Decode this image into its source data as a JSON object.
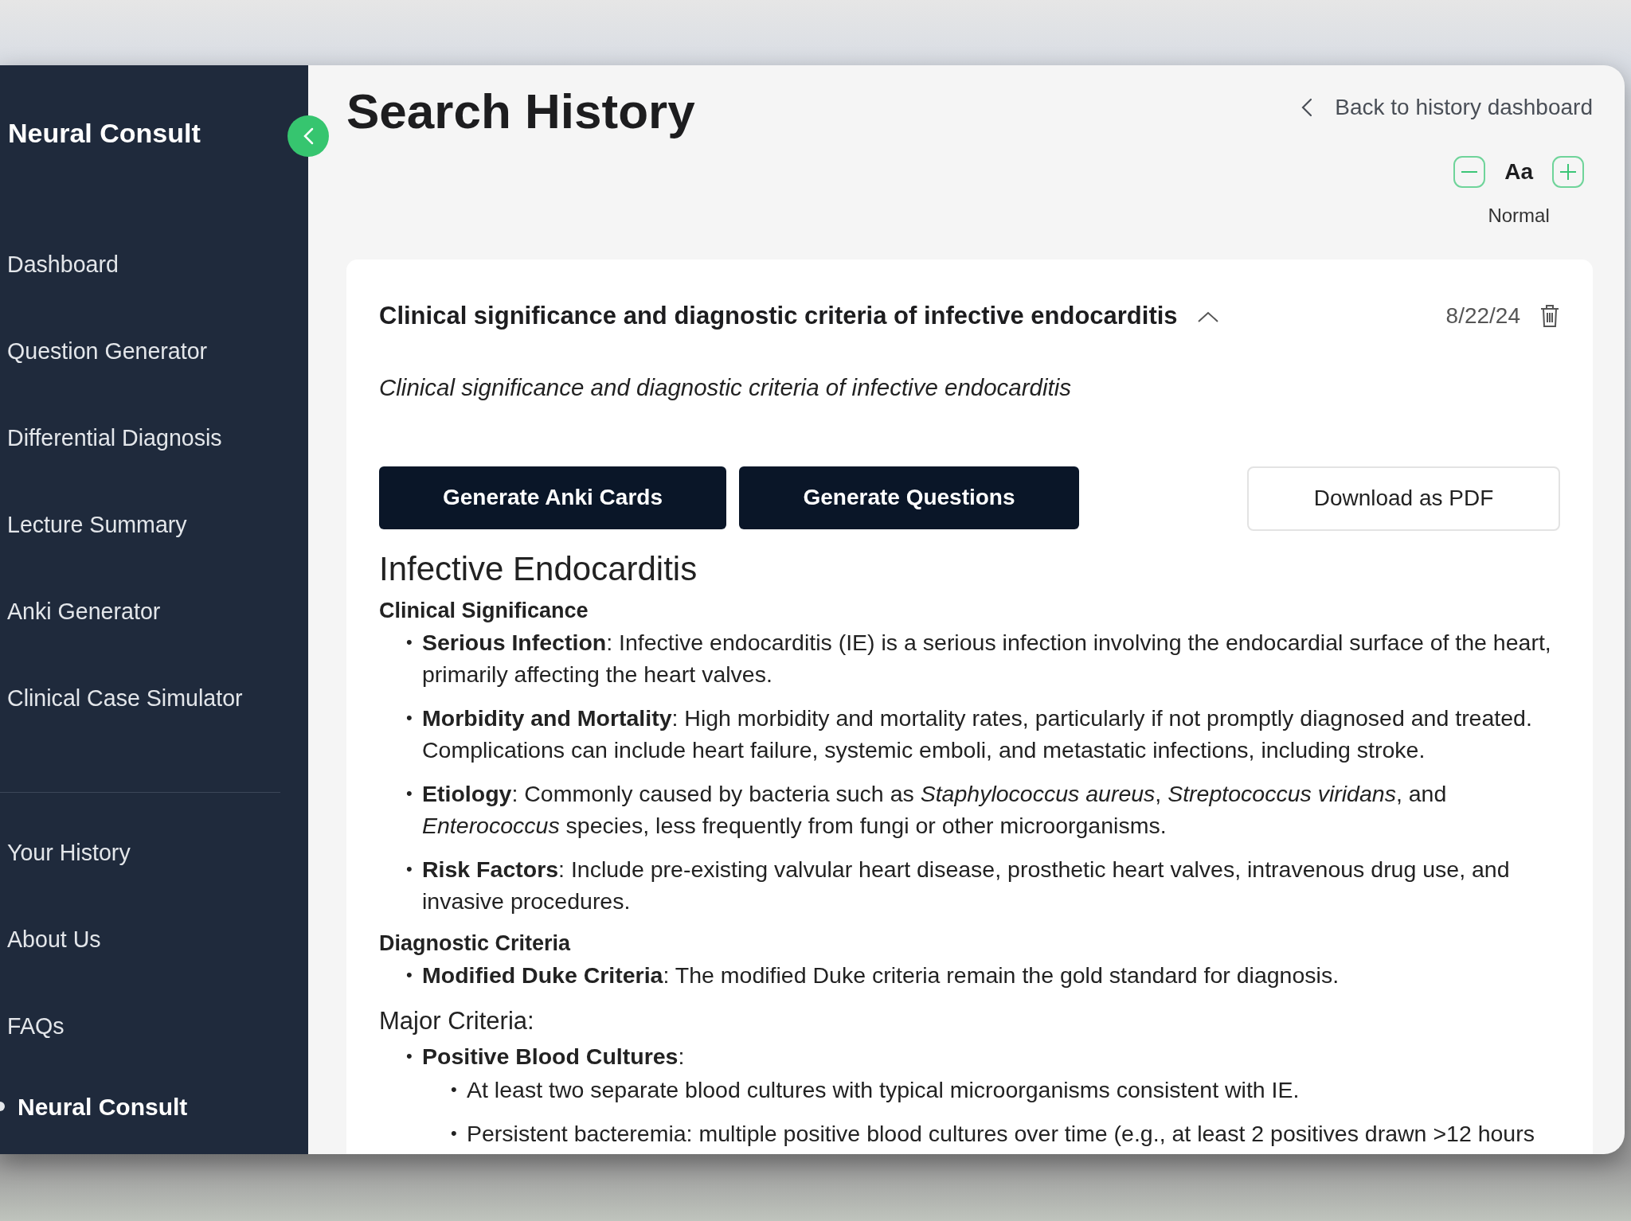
{
  "sidebar": {
    "brand": "Neural Consult",
    "items": [
      {
        "label": "Dashboard"
      },
      {
        "label": "Question Generator"
      },
      {
        "label": "Differential Diagnosis"
      },
      {
        "label": "Lecture Summary"
      },
      {
        "label": "Anki Generator"
      },
      {
        "label": "Clinical Case Simulator"
      }
    ],
    "secondary_items": [
      {
        "label": "Your History"
      },
      {
        "label": "About Us"
      },
      {
        "label": "FAQs"
      }
    ],
    "footer_brand": "Neural Consult"
  },
  "page": {
    "title": "Search History",
    "back_link": "Back to history dashboard",
    "font_size": {
      "sample": "Aa",
      "label": "Normal"
    }
  },
  "entry": {
    "title": "Clinical significance and diagnostic criteria of infective endocarditis",
    "expanded": true,
    "date": "8/22/24",
    "query": "Clinical significance and diagnostic criteria of infective endocarditis",
    "buttons": [
      {
        "label": "Generate Anki Cards",
        "kind": "primary"
      },
      {
        "label": "Generate Questions",
        "kind": "primary"
      },
      {
        "label": "Download as PDF",
        "kind": "outline"
      }
    ],
    "content": [
      {
        "kind": "title",
        "text": "Infective Endocarditis"
      },
      {
        "kind": "subheading",
        "text": "Clinical Significance"
      },
      {
        "kind": "list",
        "items": [
          {
            "marker": "•",
            "text": "**Serious Infection**: Infective endocarditis (IE) is a serious infection involving the endocardial surface of the heart, primarily affecting the heart valves."
          },
          {
            "marker": "•",
            "text": "**Morbidity and Mortality**: High morbidity and mortality rates, particularly if not promptly diagnosed and treated. Complications can include heart failure, systemic emboli, and metastatic infections, including stroke."
          },
          {
            "marker": "•",
            "text": "**Etiology**: Commonly caused by bacteria such as *Staphylococcus aureus*, *Streptococcus viridans*, and *Enterococcus* species, less frequently from fungi or other microorganisms."
          },
          {
            "marker": "•",
            "text": "**Risk Factors**: Include pre-existing valvular heart disease, prosthetic heart valves, intravenous drug use, and invasive procedures."
          }
        ]
      },
      {
        "kind": "subheading",
        "text": "Diagnostic Criteria"
      },
      {
        "kind": "list",
        "items": [
          {
            "marker": "•",
            "text": "**Modified Duke Criteria**: The modified Duke criteria remain the gold standard for diagnosis."
          }
        ]
      },
      {
        "kind": "section",
        "text": "Major Criteria:"
      },
      {
        "kind": "list",
        "items": [
          {
            "marker": "•",
            "text": "**Positive Blood Cultures**:",
            "children": [
              {
                "marker": "•",
                "text": "At least two separate blood cultures with typical microorganisms consistent with IE."
              },
              {
                "marker": "•",
                "text": "Persistent bacteremia: multiple positive blood cultures over time (e.g., at least 2 positives drawn >12 hours"
              }
            ]
          }
        ]
      }
    ]
  }
}
